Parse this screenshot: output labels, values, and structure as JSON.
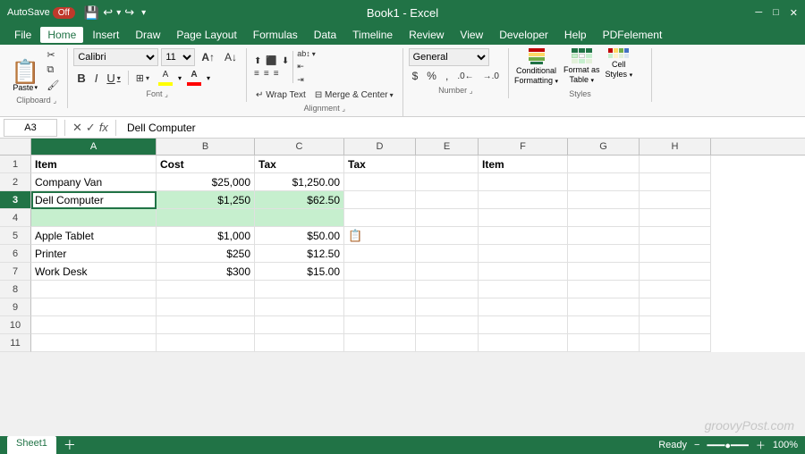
{
  "titleBar": {
    "autosave_label": "AutoSave",
    "toggle_state": "Off",
    "title": "Book1 - Excel",
    "undo_icon": "↩",
    "redo_icon": "↪"
  },
  "menuBar": {
    "items": [
      "File",
      "Home",
      "Insert",
      "Draw",
      "Page Layout",
      "Formulas",
      "Data",
      "Timeline",
      "Review",
      "View",
      "Developer",
      "Help",
      "PDFelement"
    ],
    "active": "Home"
  },
  "ribbon": {
    "clipboard": {
      "label": "Clipboard",
      "paste": "Paste"
    },
    "font": {
      "label": "Font",
      "fontName": "Calibri",
      "fontSize": "11",
      "bold": "B",
      "italic": "I",
      "underline": "U"
    },
    "alignment": {
      "label": "Alignment",
      "wrapText": "Wrap Text",
      "mergeCenter": "Merge & Center"
    },
    "number": {
      "label": "Number",
      "format": "General"
    },
    "styles": {
      "label": "Styles",
      "conditional": "Conditional Formatting",
      "formatTable": "Format as Table",
      "cellStyles": "Cell Styles"
    }
  },
  "formulaBar": {
    "cellRef": "A3",
    "formula": "Dell Computer"
  },
  "columns": {
    "headers": [
      "A",
      "B",
      "C",
      "D",
      "E",
      "F",
      "G",
      "H"
    ]
  },
  "rows": [
    {
      "num": "1",
      "cells": [
        {
          "text": "Item",
          "bold": true,
          "align": "left"
        },
        {
          "text": "Cost",
          "bold": true,
          "align": "left"
        },
        {
          "text": "Tax",
          "bold": true,
          "align": "left"
        },
        {
          "text": "Tax",
          "bold": true,
          "align": "left"
        },
        {
          "text": "",
          "align": "left"
        },
        {
          "text": "Item",
          "bold": true,
          "align": "left"
        },
        {
          "text": "",
          "align": "left"
        },
        {
          "text": "",
          "align": "left"
        }
      ]
    },
    {
      "num": "2",
      "cells": [
        {
          "text": "Company Van",
          "align": "left"
        },
        {
          "text": "$25,000",
          "align": "right"
        },
        {
          "text": "$1,250.00",
          "align": "right"
        },
        {
          "text": "",
          "align": "left"
        },
        {
          "text": "",
          "align": "left"
        },
        {
          "text": "",
          "align": "left"
        },
        {
          "text": "",
          "align": "left"
        },
        {
          "text": "",
          "align": "left"
        }
      ]
    },
    {
      "num": "3",
      "cells": [
        {
          "text": "Dell Computer",
          "align": "left",
          "selected": true
        },
        {
          "text": "$1,250",
          "align": "right",
          "gray": true
        },
        {
          "text": "$62.50",
          "align": "right",
          "gray": true
        },
        {
          "text": "",
          "align": "left"
        },
        {
          "text": "",
          "align": "left"
        },
        {
          "text": "",
          "align": "left"
        },
        {
          "text": "",
          "align": "left"
        },
        {
          "text": "",
          "align": "left"
        }
      ]
    },
    {
      "num": "4",
      "cells": [
        {
          "text": "",
          "align": "left",
          "gray": true
        },
        {
          "text": "",
          "align": "left",
          "gray": true
        },
        {
          "text": "",
          "align": "left",
          "gray": true
        },
        {
          "text": "",
          "align": "left"
        },
        {
          "text": "",
          "align": "left"
        },
        {
          "text": "",
          "align": "left"
        },
        {
          "text": "",
          "align": "left"
        },
        {
          "text": "",
          "align": "left"
        }
      ]
    },
    {
      "num": "5",
      "cells": [
        {
          "text": "Apple Tablet",
          "align": "left"
        },
        {
          "text": "$1,000",
          "align": "right"
        },
        {
          "text": "$50.00",
          "align": "right"
        },
        {
          "text": "📋",
          "align": "left",
          "pasteIcon": true
        },
        {
          "text": "",
          "align": "left"
        },
        {
          "text": "",
          "align": "left"
        },
        {
          "text": "",
          "align": "left"
        },
        {
          "text": "",
          "align": "left"
        }
      ]
    },
    {
      "num": "6",
      "cells": [
        {
          "text": "Printer",
          "align": "left"
        },
        {
          "text": "$250",
          "align": "right"
        },
        {
          "text": "$12.50",
          "align": "right"
        },
        {
          "text": "",
          "align": "left"
        },
        {
          "text": "",
          "align": "left"
        },
        {
          "text": "",
          "align": "left"
        },
        {
          "text": "",
          "align": "left"
        },
        {
          "text": "",
          "align": "left"
        }
      ]
    },
    {
      "num": "7",
      "cells": [
        {
          "text": "Work Desk",
          "align": "left"
        },
        {
          "text": "$300",
          "align": "right"
        },
        {
          "text": "$15.00",
          "align": "right"
        },
        {
          "text": "",
          "align": "left"
        },
        {
          "text": "",
          "align": "left"
        },
        {
          "text": "",
          "align": "left"
        },
        {
          "text": "",
          "align": "left"
        },
        {
          "text": "",
          "align": "left"
        }
      ]
    },
    {
      "num": "8",
      "cells": [
        {
          "text": ""
        },
        {
          "text": ""
        },
        {
          "text": ""
        },
        {
          "text": ""
        },
        {
          "text": ""
        },
        {
          "text": ""
        },
        {
          "text": ""
        },
        {
          "text": ""
        }
      ]
    },
    {
      "num": "9",
      "cells": [
        {
          "text": ""
        },
        {
          "text": ""
        },
        {
          "text": ""
        },
        {
          "text": ""
        },
        {
          "text": ""
        },
        {
          "text": ""
        },
        {
          "text": ""
        },
        {
          "text": ""
        }
      ]
    },
    {
      "num": "10",
      "cells": [
        {
          "text": ""
        },
        {
          "text": ""
        },
        {
          "text": ""
        },
        {
          "text": ""
        },
        {
          "text": ""
        },
        {
          "text": ""
        },
        {
          "text": ""
        },
        {
          "text": ""
        }
      ]
    },
    {
      "num": "11",
      "cells": [
        {
          "text": ""
        },
        {
          "text": ""
        },
        {
          "text": ""
        },
        {
          "text": ""
        },
        {
          "text": ""
        },
        {
          "text": ""
        },
        {
          "text": ""
        },
        {
          "text": ""
        }
      ]
    }
  ],
  "statusBar": {
    "sheetTab": "Sheet1",
    "watermark": "groovyPost.com"
  }
}
